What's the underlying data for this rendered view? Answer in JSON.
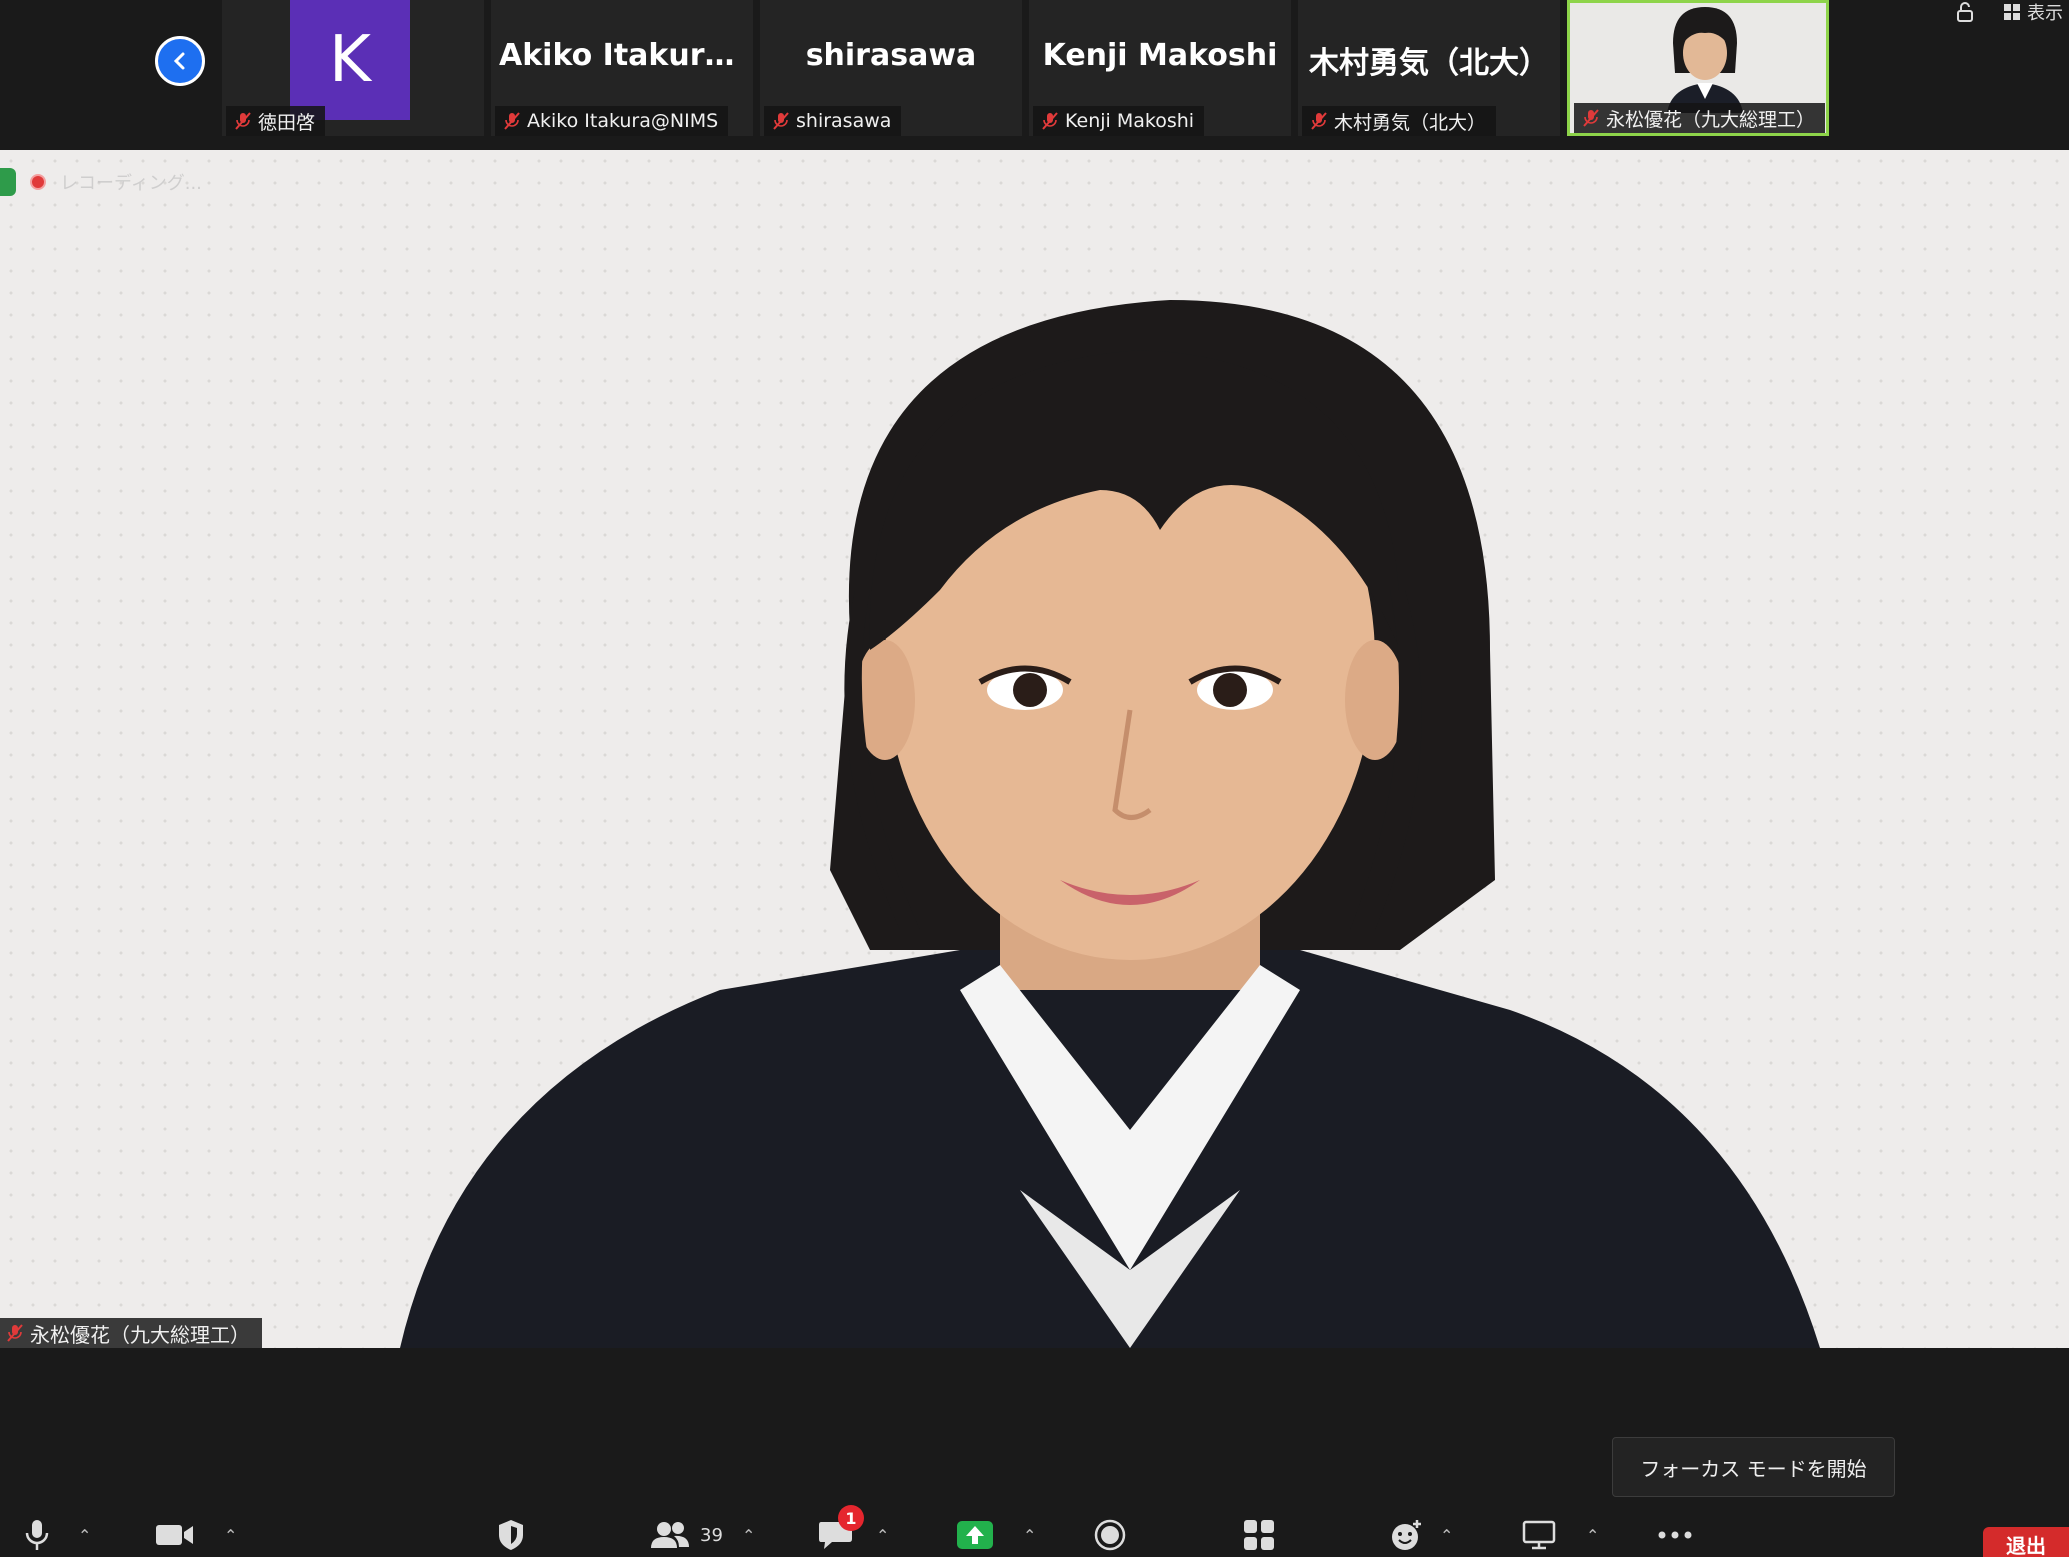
{
  "strip": {
    "participants": [
      {
        "big_name": "",
        "tag": "徳田啓",
        "avatar_letter": "K"
      },
      {
        "big_name": "Akiko  Itakura@...",
        "tag": "Akiko Itakura@NIMS"
      },
      {
        "big_name": "shirasawa",
        "tag": "shirasawa"
      },
      {
        "big_name": "Kenji Makoshi",
        "tag": "Kenji Makoshi"
      },
      {
        "big_name": "木村勇気（北大）",
        "tag": "木村勇気（北大）"
      },
      {
        "big_name": "",
        "tag": "永松優花（九大総理工）"
      }
    ],
    "view_label": "表示"
  },
  "main": {
    "recording_label": "レコーディング...",
    "name_tag": "永松優花（九大総理工）"
  },
  "focus_button": "フォーカス モードを開始",
  "toolbar": {
    "participants_count": "39",
    "chat_badge": "1",
    "leave_label": "退出"
  },
  "colors": {
    "accent_blue": "#1e6ff0",
    "avatar_purple": "#5b2fb6",
    "active_border": "#8ed44a",
    "share_green": "#22b14c",
    "leave_red": "#d42b2b",
    "badge_red": "#e5262e"
  },
  "icons": [
    "chevron-left-icon",
    "mic-muted-icon",
    "mic-icon",
    "video-icon",
    "security-icon",
    "participants-icon",
    "chat-icon",
    "share-screen-icon",
    "record-icon",
    "apps-icon",
    "reaction-icon",
    "whiteboard-icon",
    "more-icon",
    "lock-icon",
    "grid-view-icon"
  ]
}
